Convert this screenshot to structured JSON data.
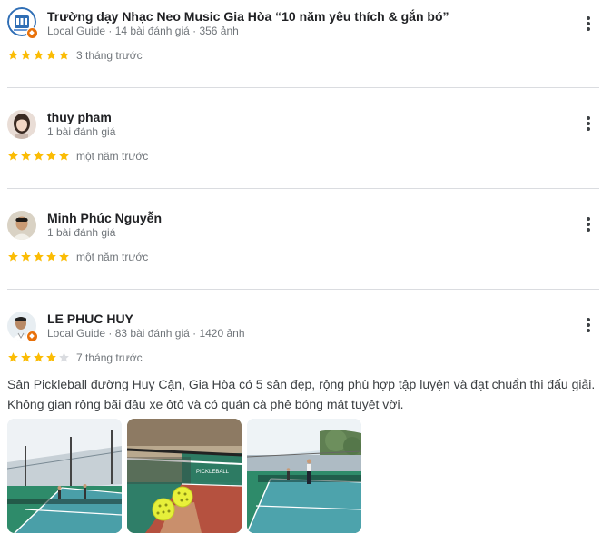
{
  "reviews": [
    {
      "name": "Trường dạy Nhạc Neo Music Gia Hòa “10 năm yêu thích & gắn bó”",
      "meta": "Local Guide · 14 bài đánh giá · 356 ảnh",
      "rating": 5,
      "time": "3 tháng trước"
    },
    {
      "name": "thuy pham",
      "meta": "1 bài đánh giá",
      "rating": 5,
      "time": "một năm trước"
    },
    {
      "name": "Minh Phúc Nguyễn",
      "meta": "1 bài đánh giá",
      "rating": 5,
      "time": "một năm trước"
    },
    {
      "name": "LE PHUC HUY",
      "meta": "Local Guide · 83 bài đánh giá · 1420 ảnh",
      "rating": 4,
      "time": "7 tháng trước",
      "text": "Sân Pickleball đường Huy Cận, Gia Hòa có 5 sân đẹp, rộng phù hợp tập luyện và đạt chuẩn thi đấu giải. Không gian rộng bãi đậu xe ôtô và có quán cà phê bóng mát tuyệt vời.",
      "photo_banner_text": "PICKLEBALL"
    }
  ],
  "colors": {
    "star_filled": "#fbbc04",
    "star_empty": "#dadce0",
    "local_guide_badge": "#e8710a",
    "court_green": "#2e8b6a"
  },
  "icons": {
    "more": "more-vert-icon",
    "star": "star-icon",
    "badge": "local-guide-badge-icon"
  }
}
